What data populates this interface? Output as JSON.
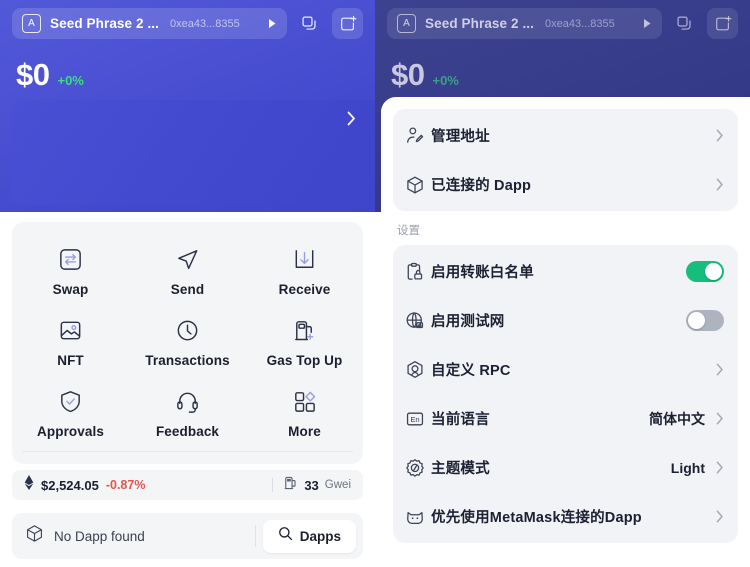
{
  "colors": {
    "header_purple": "#4b51d2",
    "header_purple_dim": "#383d8c",
    "accent_green": "#3ddc84",
    "toggle_on": "#16bd7d",
    "toggle_off": "#aeb4bf",
    "negative_red": "#e8544a",
    "card_gray": "#f4f5f7"
  },
  "account": {
    "avatar_letter": "A",
    "name": "Seed Phrase 2 ...",
    "address": "0xea43...8355",
    "caret_icon": "caret-right-icon",
    "copy_icon": "copy-icon",
    "add_account_icon": "add-account-icon"
  },
  "balance": {
    "amount": "$0",
    "change": "+0%"
  },
  "promo": {
    "chevron_icon": "chevron-right-icon"
  },
  "actions": [
    {
      "label": "Swap",
      "icon": "swap-icon"
    },
    {
      "label": "Send",
      "icon": "send-icon"
    },
    {
      "label": "Receive",
      "icon": "receive-icon"
    },
    {
      "label": "NFT",
      "icon": "nft-image-icon"
    },
    {
      "label": "Transactions",
      "icon": "clock-icon"
    },
    {
      "label": "Gas Top Up",
      "icon": "gas-pump-plus-icon"
    },
    {
      "label": "Approvals",
      "icon": "shield-check-icon"
    },
    {
      "label": "Feedback",
      "icon": "headset-icon"
    },
    {
      "label": "More",
      "icon": "grid-more-icon"
    }
  ],
  "price_bar": {
    "token_icon": "ethereum-icon",
    "price": "$2,524.05",
    "change": "-0.87%",
    "gas_icon": "gas-pump-icon",
    "gas_value": "33",
    "gas_unit": "Gwei"
  },
  "dapp_bar": {
    "icon": "cube-icon",
    "text": "No Dapp found",
    "button_icon": "search-icon",
    "button_label": "Dapps"
  },
  "sheet": {
    "top_group": [
      {
        "label": "管理地址",
        "icon": "user-edit-icon",
        "type": "chevron"
      },
      {
        "label": "已连接的 Dapp",
        "icon": "cube-icon",
        "type": "chevron"
      }
    ],
    "section_label": "设置",
    "settings_group": [
      {
        "label": "启用转账白名单",
        "icon": "clipboard-lock-icon",
        "type": "toggle",
        "value": "on"
      },
      {
        "label": "启用测试网",
        "icon": "globe-icon",
        "type": "toggle",
        "value": "off"
      },
      {
        "label": "自定义 RPC",
        "icon": "rpc-node-icon",
        "type": "chevron"
      },
      {
        "label": "当前语言",
        "icon": "language-en-icon",
        "type": "value",
        "value": "简体中文"
      },
      {
        "label": "主题模式",
        "icon": "theme-sun-icon",
        "type": "value",
        "value": "Light"
      },
      {
        "label": "优先使用MetaMask连接的Dapp",
        "icon": "metamask-fox-icon",
        "type": "chevron"
      }
    ]
  }
}
